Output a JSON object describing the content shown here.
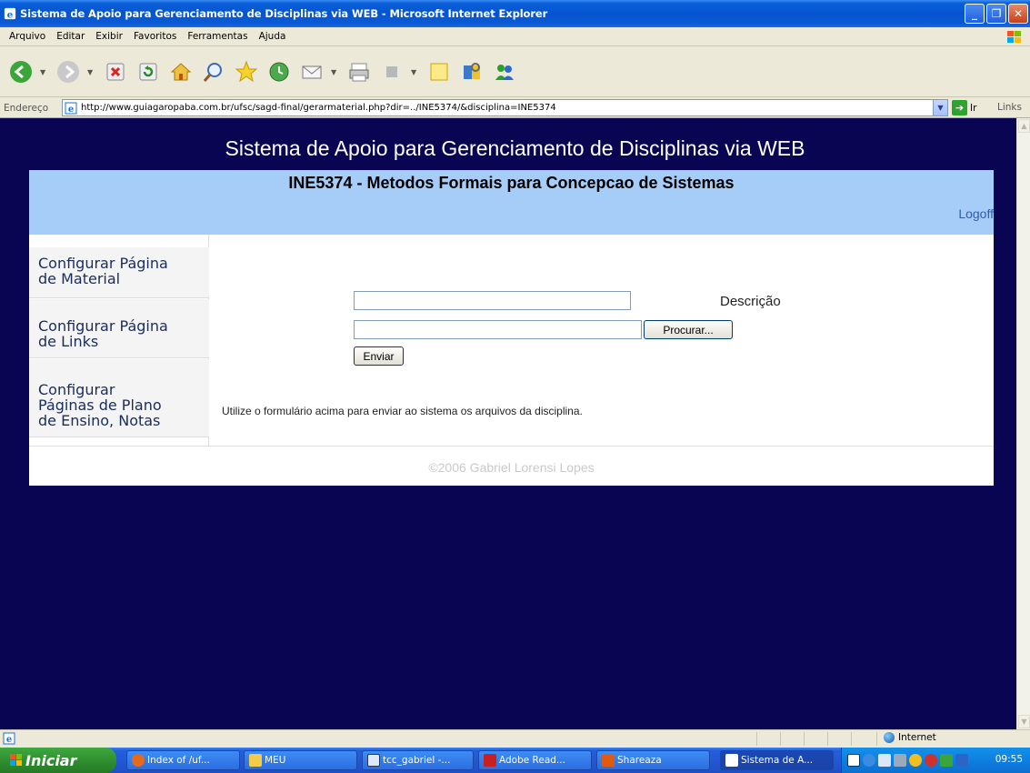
{
  "window": {
    "title": "Sistema de Apoio para Gerenciamento de Disciplinas via WEB - Microsoft Internet Explorer"
  },
  "menu": [
    "Arquivo",
    "Editar",
    "Exibir",
    "Favoritos",
    "Ferramentas",
    "Ajuda"
  ],
  "address": {
    "label": "Endereço",
    "url": "http://www.guiagaropaba.com.br/ufsc/sagd-final/gerarmaterial.php?dir=../INE5374/&disciplina=INE5374",
    "go_label": "Ir",
    "links_label": "Links"
  },
  "page": {
    "site_title": "Sistema de Apoio para Gerenciamento de Disciplinas via WEB",
    "course_title": "INE5374 - Metodos Formais para Concepcao de Sistemas",
    "logoff": "Logoff",
    "sidebar": [
      {
        "lines": [
          "Configurar Página",
          "de Material"
        ]
      },
      {
        "lines": [
          "Configurar Página",
          "de Links"
        ]
      },
      {
        "lines": [
          "Configurar",
          "Páginas de Plano",
          "de Ensino, Notas"
        ]
      }
    ],
    "form": {
      "description_label": "Descrição",
      "description_value": "",
      "file_value": "",
      "browse_button": "Procurar...",
      "submit_button": "Enviar"
    },
    "info_text": "Utilize o formulário acima para enviar ao sistema os arquivos da disciplina.",
    "copyright": "©2006 Gabriel Lorensi Lopes"
  },
  "statusbar": {
    "zone": "Internet"
  },
  "taskbar": {
    "start": "Iniciar",
    "tasks": [
      "Index of /uf...",
      "MEU",
      "tcc_gabriel -...",
      "Adobe Read...",
      "Shareaza",
      "Sistema de A..."
    ],
    "clock": "09:55"
  },
  "colors": {
    "page_background": "#0a0552",
    "banner": "#a6cdf8",
    "logoff_link": "#2d5ea8"
  }
}
